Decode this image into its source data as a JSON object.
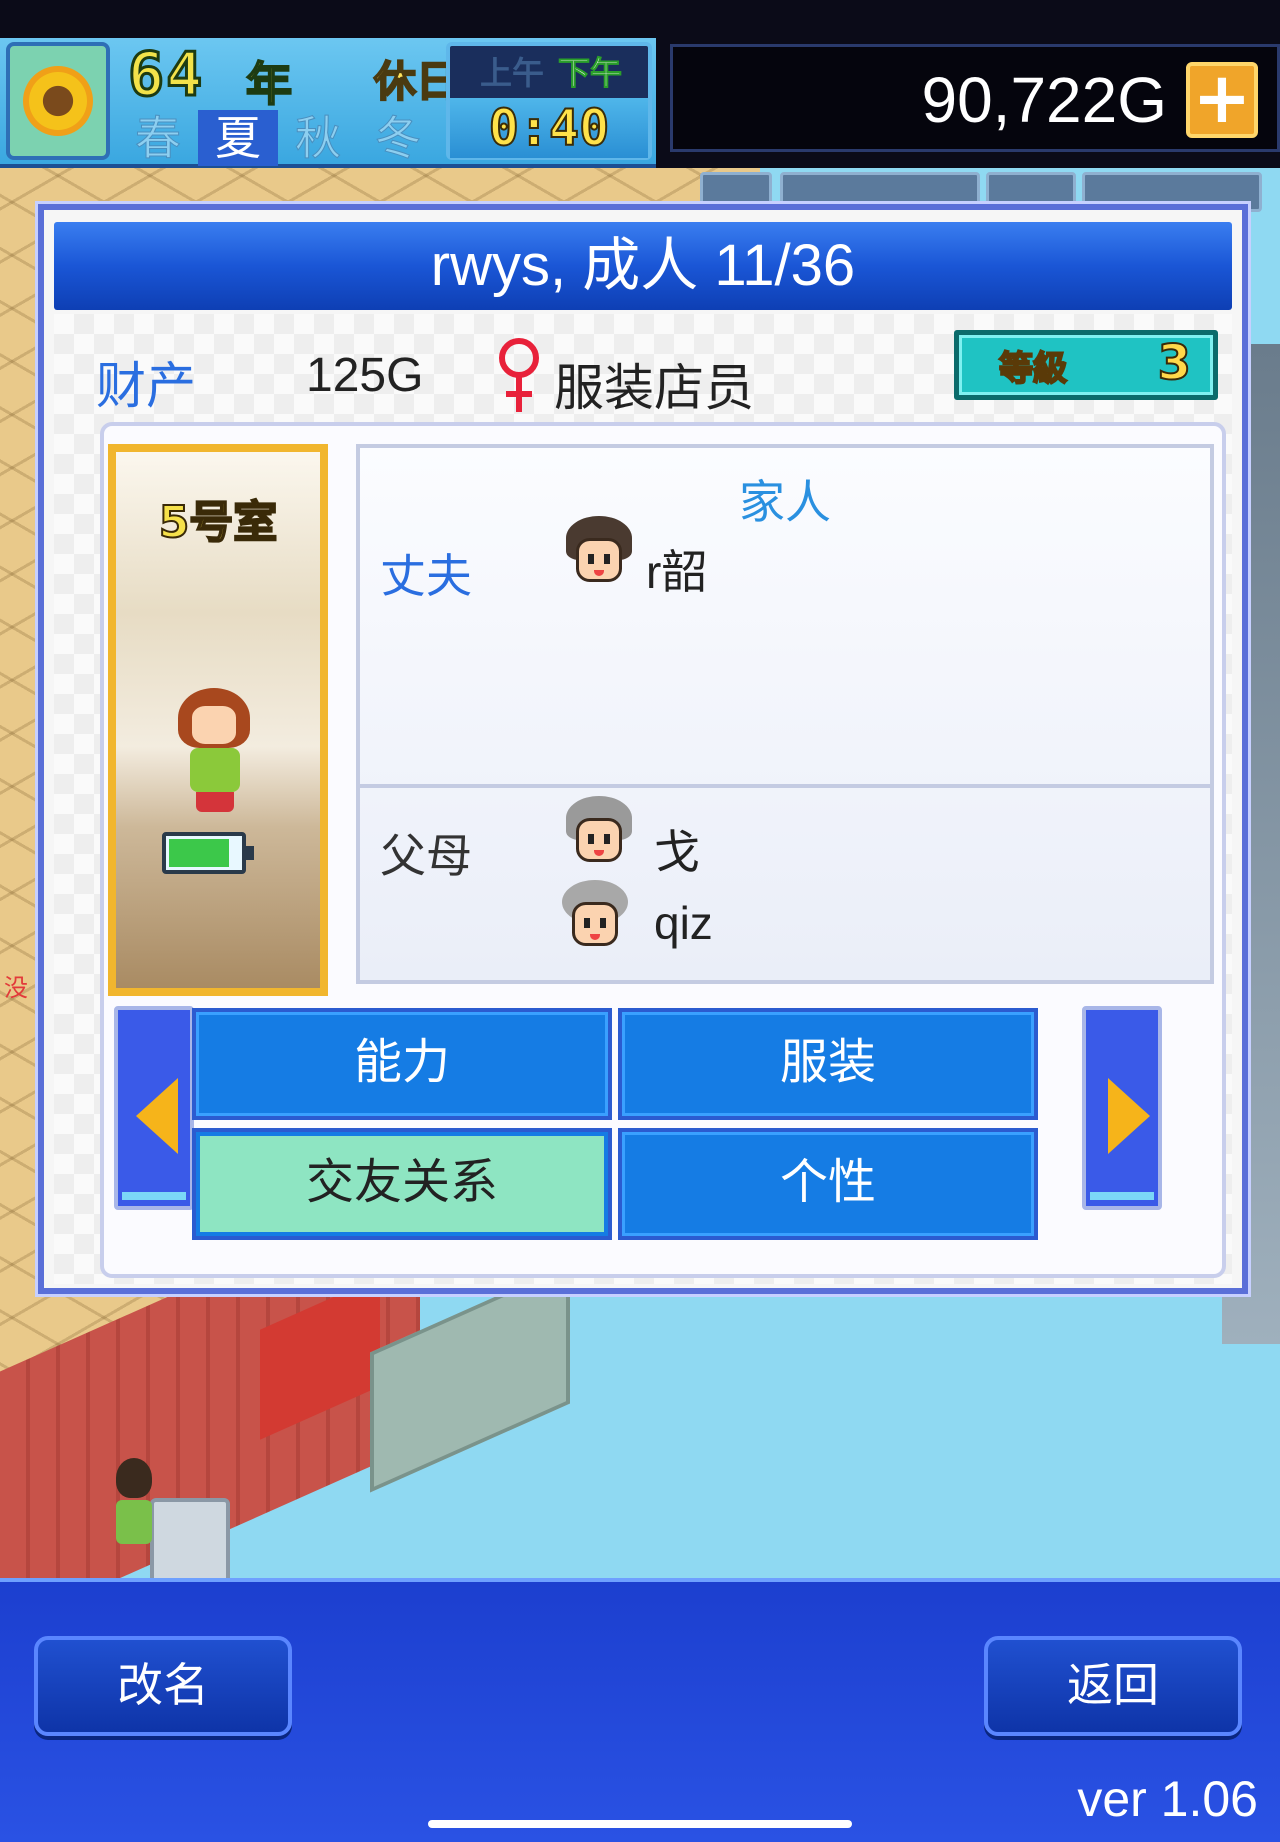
{
  "hud": {
    "year": "64",
    "year_unit": "年",
    "holiday": "休日",
    "am": "上午",
    "pm": "下午",
    "time": "0:40",
    "seasons": [
      "春",
      "夏",
      "秋",
      "冬"
    ],
    "active_season": "夏",
    "money": "90,722G",
    "add_money_symbol": "+"
  },
  "world": {
    "side_label": "没"
  },
  "dialog": {
    "title": "rwys, 成人 11/36",
    "asset_label": "财产",
    "asset_value": "125G",
    "gender_icon": "female-symbol",
    "job": "服装店员",
    "level_label": "等級",
    "level_value": "3",
    "room": "5号室",
    "stamina_level": 0.85,
    "family": {
      "heading": "家人",
      "spouse_label": "丈夫",
      "spouse_name": "r韶",
      "parents_label": "父母",
      "parents": [
        {
          "name": "戈"
        },
        {
          "name": "qiz"
        }
      ]
    },
    "tabs": {
      "ability": "能力",
      "clothing": "服装",
      "relations": "交友关系",
      "personality": "个性",
      "selected": "交友关系"
    }
  },
  "bottom": {
    "rename_label": "改名",
    "back_label": "返回",
    "version": "ver 1.06"
  },
  "colors": {
    "accent_blue": "#157ce4",
    "selected_tab": "#8ee5c2",
    "title_blue": "#1a56d6",
    "level_teal": "#1fc3c3",
    "room_frame": "#f1b62e"
  }
}
